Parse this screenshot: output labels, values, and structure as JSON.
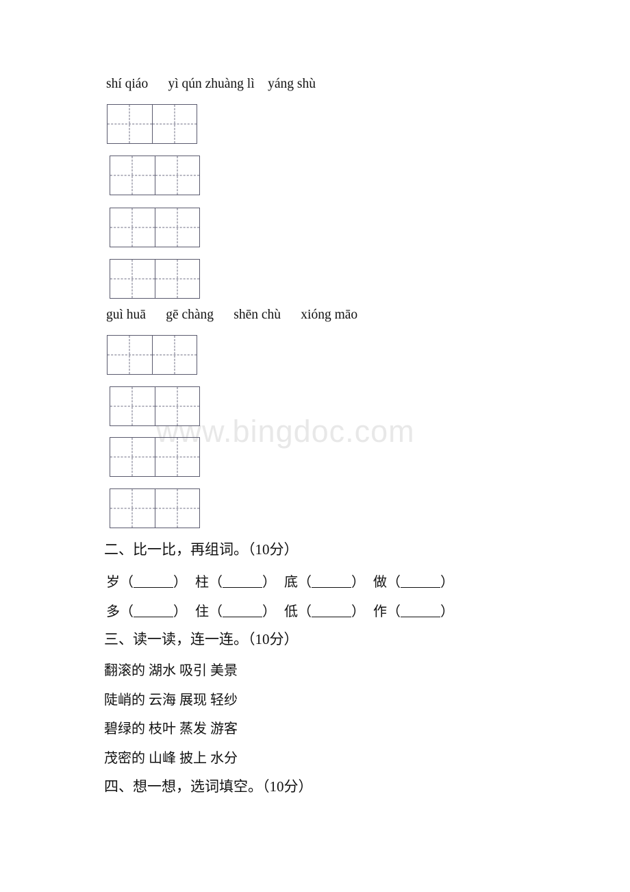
{
  "document": {
    "type": "chinese-language-worksheet",
    "watermark": "www.bingdoc.com"
  },
  "pinyin_exercise": {
    "group1": {
      "prompt": "shí qiáo      yì qún zhuàng lì    yáng shù",
      "boxes": [
        {
          "cells": 2
        },
        {
          "cells": 2
        },
        {
          "cells": 2
        },
        {
          "cells": 2
        }
      ]
    },
    "group2": {
      "prompt": "guì huā      gē chàng      shēn chù      xióng māo",
      "boxes": [
        {
          "cells": 2
        },
        {
          "cells": 2
        },
        {
          "cells": 2
        },
        {
          "cells": 2
        }
      ]
    }
  },
  "section_two": {
    "heading": "二、比一比，再组词。（10分）",
    "rows": [
      [
        {
          "char": "岁"
        },
        {
          "char": "柱"
        },
        {
          "char": "底"
        },
        {
          "char": "做"
        }
      ],
      [
        {
          "char": "多"
        },
        {
          "char": "住"
        },
        {
          "char": "低"
        },
        {
          "char": "作"
        }
      ]
    ],
    "open_paren": "（",
    "close_paren": "）"
  },
  "section_three": {
    "heading": "三、读一读，连一连。（10分）",
    "rows": [
      "翻滚的 湖水 吸引 美景",
      "陡峭的 云海 展现 轻纱",
      "碧绿的 枝叶 蒸发 游客",
      "茂密的 山峰 披上 水分"
    ]
  },
  "section_four": {
    "heading": "四、想一想，选词填空。（10分）"
  }
}
